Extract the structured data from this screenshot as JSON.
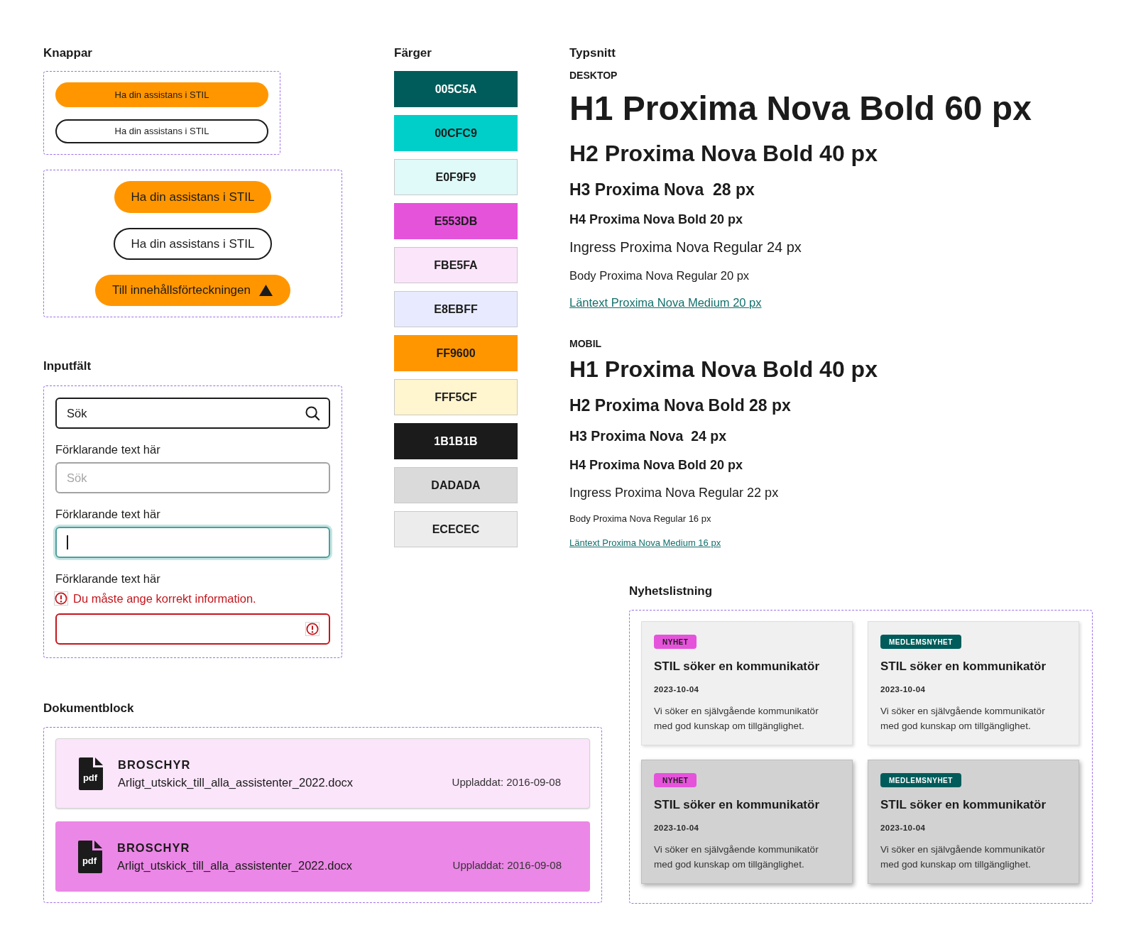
{
  "buttons": {
    "heading": "Knappar",
    "groups": [
      {
        "kind": "small",
        "items": [
          {
            "kind": "filled",
            "label": "Ha din assistans i STIL"
          },
          {
            "kind": "outline",
            "label": "Ha din assistans i STIL"
          }
        ]
      },
      {
        "kind": "large",
        "items": [
          {
            "kind": "filled",
            "label": "Ha din assistans i STIL"
          },
          {
            "kind": "outline",
            "label": "Ha din assistans i STIL"
          },
          {
            "kind": "filled-arrow",
            "label": "Till innehållsförteckningen"
          }
        ]
      }
    ]
  },
  "inputs": {
    "heading": "Inputfält",
    "fields": [
      {
        "kind": "search",
        "value": "Sök",
        "focused": false,
        "invalid": false
      },
      {
        "kind": "text",
        "label": "Förklarande text här",
        "placeholder": "Sök",
        "focused": false,
        "invalid": false
      },
      {
        "kind": "text",
        "label": "Förklarande text här",
        "focused": true,
        "invalid": false
      },
      {
        "kind": "text",
        "label": "Förklarande text här",
        "error": "Du måste ange korrekt information.",
        "focused": false,
        "invalid": true
      }
    ]
  },
  "colors": {
    "heading": "Färger",
    "swatches": [
      {
        "label": "005C5A",
        "color": "#005c5a"
      },
      {
        "label": "00CFC9",
        "color": "#00cfc9"
      },
      {
        "label": "E0F9F9",
        "color": "#e0f9f9"
      },
      {
        "label": "E553DB",
        "color": "#e553db"
      },
      {
        "label": "FBE5FA",
        "color": "#fbe5fa"
      },
      {
        "label": "E8EBFF",
        "color": "#e8ebff"
      },
      {
        "label": "FF9600",
        "color": "#ff9600"
      },
      {
        "label": "FFF5CF",
        "color": "#fff5cf"
      },
      {
        "label": "1B1B1B",
        "color": "#1b1b1b"
      },
      {
        "label": "DADADA",
        "color": "#dadada"
      },
      {
        "label": "ECECEC",
        "color": "#ececec"
      }
    ]
  },
  "typography": {
    "heading": "Typsnitt",
    "groups": [
      {
        "kind": "desktop",
        "label": "DESKTOP",
        "samples": [
          {
            "kind": "h1",
            "text": "H1 Proxima Nova Bold 60 px"
          },
          {
            "kind": "h2",
            "text": "H2 Proxima Nova Bold 40 px"
          },
          {
            "kind": "h3",
            "text": "H3 Proxima Nova  28 px"
          },
          {
            "kind": "h4",
            "text": "H4 Proxima Nova Bold 20 px"
          },
          {
            "kind": "ingress",
            "text": "Ingress Proxima Nova Regular 24 px"
          },
          {
            "kind": "body",
            "text": "Body Proxima Nova Regular 20 px"
          },
          {
            "kind": "link",
            "text": "Läntext Proxima Nova Medium 20 px"
          }
        ]
      },
      {
        "kind": "mobile",
        "label": "MOBIL",
        "samples": [
          {
            "kind": "h1",
            "text": "H1 Proxima Nova Bold 40 px"
          },
          {
            "kind": "h2",
            "text": "H2 Proxima Nova Bold 28 px"
          },
          {
            "kind": "h3",
            "text": "H3 Proxima Nova  24 px"
          },
          {
            "kind": "h4",
            "text": "H4 Proxima Nova Bold 20 px"
          },
          {
            "kind": "ingress",
            "text": "Ingress Proxima Nova Regular 22 px"
          },
          {
            "kind": "body",
            "text": "Body Proxima Nova Regular 16 px"
          },
          {
            "kind": "link",
            "text": "Läntext Proxima Nova Medium 16 px"
          }
        ]
      }
    ]
  },
  "documents": {
    "heading": "Dokumentblock",
    "items": [
      {
        "file_type": "pdf",
        "category": "BROSCHYR",
        "filename": "Arligt_utskick_till_alla_assistenter_2022.docx",
        "uploaded": "Uppladdat: 2016-09-08",
        "hovered": false
      },
      {
        "file_type": "pdf",
        "category": "BROSCHYR",
        "filename": "Arligt_utskick_till_alla_assistenter_2022.docx",
        "uploaded": "Uppladdat: 2016-09-08",
        "hovered": true
      }
    ]
  },
  "news": {
    "heading": "Nyhetslistning",
    "cards": [
      {
        "tag": {
          "label": "NYHET",
          "color": "#e553db"
        },
        "title": "STIL söker en kommunikatör",
        "date": "2023-10-04",
        "text": "Vi söker en självgående kommunikatör med god kunskap om tillgänglighet.",
        "hovered": false
      },
      {
        "tag": {
          "label": "MEDLEMSNYHET",
          "color": "#005c5a"
        },
        "title": "STIL söker en kommunikatör",
        "date": "2023-10-04",
        "text": "Vi söker en självgående kommunikatör med god kunskap om tillgänglighet.",
        "hovered": false
      },
      {
        "tag": {
          "label": "NYHET",
          "color": "#e553db"
        },
        "title": "STIL söker en kommunikatör",
        "date": "2023-10-04",
        "text": "Vi söker en självgående kommunikatör med god kunskap om tillgänglighet.",
        "hovered": true
      },
      {
        "tag": {
          "label": "MEDLEMSNYHET",
          "color": "#005c5a"
        },
        "title": "STIL söker en kommunikatör",
        "date": "2023-10-04",
        "text": "Vi söker en självgående kommunikatör med god kunskap om tillgänglighet.",
        "hovered": true
      }
    ]
  }
}
